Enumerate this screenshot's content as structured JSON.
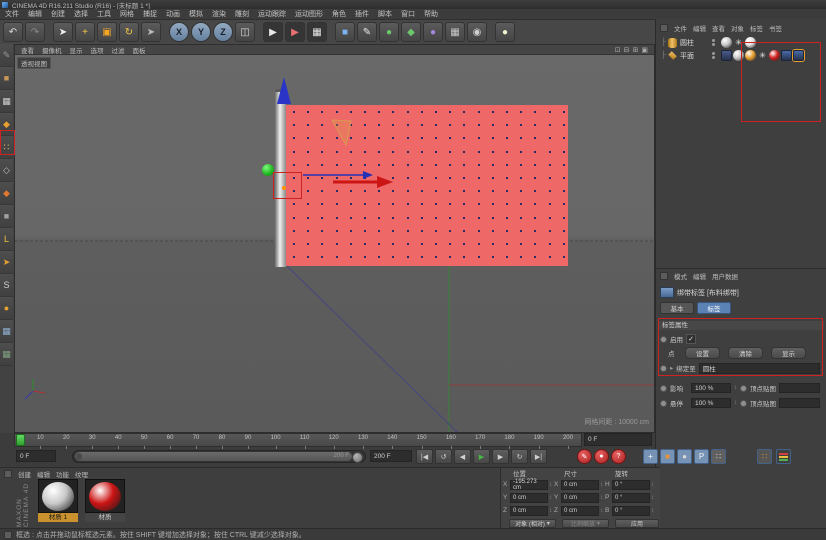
{
  "window": {
    "title": "CINEMA 4D R16.211 Studio (R16) - [未标题 1 *]"
  },
  "menu_bar": {
    "items": [
      "文件",
      "编辑",
      "创建",
      "选择",
      "工具",
      "网格",
      "捕捉",
      "动画",
      "模拟",
      "渲染",
      "雕刻",
      "运动跟踪",
      "运动图形",
      "角色",
      "插件",
      "脚本",
      "窗口",
      "帮助"
    ]
  },
  "toolbar": {
    "items": [
      {
        "name": "undo-icon",
        "glyph": "↶",
        "color": "#d8d8d8"
      },
      {
        "name": "redo-icon",
        "glyph": "↷",
        "color": "#8a8a8a"
      },
      {
        "sep": true
      },
      {
        "name": "live-selection-icon",
        "glyph": "➤",
        "color": "#f0f0f0"
      },
      {
        "name": "move-tool-icon",
        "glyph": "+",
        "color": "#f5c542"
      },
      {
        "name": "scale-tool-icon",
        "glyph": "▣",
        "color": "#f5a623"
      },
      {
        "name": "rotate-tool-icon",
        "glyph": "↻",
        "color": "#f5c542"
      },
      {
        "name": "last-tool-icon",
        "glyph": "➤",
        "color": "#bdbdbd"
      },
      {
        "sep": true
      },
      {
        "name": "lock-x-icon",
        "glyph": "X",
        "round": true
      },
      {
        "name": "lock-y-icon",
        "glyph": "Y",
        "round": true
      },
      {
        "name": "lock-z-icon",
        "glyph": "Z",
        "round": true
      },
      {
        "name": "coordinate-system-icon",
        "glyph": "◫",
        "color": "#d8d8d8"
      },
      {
        "sep": true
      },
      {
        "name": "render-view-icon",
        "glyph": "▶",
        "color": "#e8e8e8",
        "bg": "#353535"
      },
      {
        "name": "render-picture-viewer-icon",
        "glyph": "▶",
        "color": "#e87070",
        "bg": "#353535"
      },
      {
        "name": "render-settings-icon",
        "glyph": "▦",
        "color": "#e8e8e8",
        "bg": "#353535"
      },
      {
        "sep": true
      },
      {
        "name": "add-cube-icon",
        "glyph": "■",
        "color": "#7ab4f0"
      },
      {
        "name": "spline-pen-icon",
        "glyph": "✎",
        "color": "#e8e8e8"
      },
      {
        "name": "generators-icon",
        "glyph": "●",
        "color": "#6cc86c"
      },
      {
        "name": "deformers-icon",
        "glyph": "◆",
        "color": "#6cc86c"
      },
      {
        "name": "environment-icon",
        "glyph": "●",
        "color": "#a488e0"
      },
      {
        "name": "floor-icon",
        "glyph": "▦",
        "color": "#c8c8c8"
      },
      {
        "name": "camera-icon",
        "glyph": "◉",
        "color": "#d0d0d0"
      },
      {
        "sep": true
      },
      {
        "name": "light-icon",
        "glyph": "●",
        "color": "#f5f2d0"
      }
    ]
  },
  "left_toolbar": {
    "items": [
      {
        "name": "make-editable-icon",
        "glyph": "✎",
        "color": "#9a9a9a"
      },
      {
        "name": "model-mode-icon",
        "glyph": "■",
        "color": "#c89858"
      },
      {
        "name": "texture-mode-icon",
        "glyph": "▦",
        "color": "#d0d0d0"
      },
      {
        "name": "workplane-mode-icon",
        "glyph": "◆",
        "color": "#e8a030"
      },
      {
        "name": "points-mode-icon",
        "glyph": "∷",
        "color": "#e8c060"
      },
      {
        "name": "edges-mode-icon",
        "glyph": "◇",
        "color": "#c0c0c0"
      },
      {
        "name": "polygons-mode-icon",
        "glyph": "◆",
        "color": "#e07830"
      },
      {
        "name": "tweak-mode-icon",
        "glyph": "■",
        "color": "#a0a0a0"
      },
      {
        "name": "enable-axis-icon",
        "glyph": "L",
        "color": "#f0c040"
      },
      {
        "name": "viewport-solo-icon",
        "glyph": "➤",
        "color": "#e8a030"
      },
      {
        "name": "snap-icon",
        "glyph": "S",
        "color": "#d0d0d0"
      },
      {
        "name": "magnet-snap-icon",
        "glyph": "●",
        "color": "#e8a030"
      },
      {
        "name": "lock-workplane-icon",
        "glyph": "▦",
        "color": "#90b0d0"
      },
      {
        "name": "workplane-icon",
        "glyph": "▦",
        "color": "#80a080"
      }
    ]
  },
  "viewport": {
    "menu": [
      "查看",
      "摄像机",
      "显示",
      "选项",
      "过滤",
      "面板"
    ],
    "corner_icons": [
      {
        "name": "pane-toggle-icon-1",
        "glyph": "⊡"
      },
      {
        "name": "pane-toggle-icon-2",
        "glyph": "⊟"
      },
      {
        "name": "pane-toggle-icon-3",
        "glyph": "⊞"
      },
      {
        "name": "pane-maximize-icon",
        "glyph": "▣"
      }
    ],
    "view_label": "透视视图",
    "grid_label": "网格间距 : 10000 cm",
    "flag": {
      "rows": 12,
      "cols": 20
    }
  },
  "object_manager": {
    "menu": [
      "文件",
      "编辑",
      "查看",
      "对象",
      "标签",
      "书签"
    ],
    "objects": [
      {
        "name": "圆柱",
        "icon": "cylinder",
        "tags": [
          {
            "name": "phong-tag",
            "type": "ball",
            "color": "#c8c8c8"
          },
          {
            "name": "simulation-tag",
            "type": "glyph",
            "glyph": "✳",
            "color": "#e8e8e8"
          },
          {
            "name": "material-tag-silver",
            "type": "ball",
            "color": "#e0e0e0"
          }
        ]
      },
      {
        "name": "平面",
        "icon": "plane",
        "tags": [
          {
            "name": "cloth-tag",
            "type": "box",
            "color": "#4a5a8a"
          },
          {
            "name": "phong-tag",
            "type": "ball",
            "color": "#c8c8c8"
          },
          {
            "name": "display-tag",
            "type": "ball",
            "color": "#e8a030"
          },
          {
            "name": "simulation-tag",
            "type": "glyph",
            "glyph": "✳",
            "color": "#e8e8e8"
          },
          {
            "name": "material-tag-red",
            "type": "ball",
            "color": "#d02020"
          },
          {
            "name": "cloth-collider-tag",
            "type": "box",
            "color": "#4a6aa8"
          },
          {
            "name": "cloth-belt-tag",
            "type": "box",
            "color": "#4a6aa8",
            "selected": true
          }
        ]
      }
    ]
  },
  "attribute_manager": {
    "menu": [
      "模式",
      "编辑",
      "用户数据"
    ],
    "title": "绑带标签 [布料绑带]",
    "tabs": [
      "基本",
      "标签"
    ],
    "section": "标签属性",
    "enable_label": "启用",
    "points_label": "点",
    "point_buttons": [
      "设置",
      "清除",
      "显示"
    ],
    "belt_on_label": "绑定至",
    "belt_on_value": "圆柱",
    "rows": [
      {
        "label": "影响",
        "value": "100 %",
        "map_label": "顶点贴图"
      },
      {
        "label": "悬停",
        "value": "100 %",
        "map_label": "顶点贴图"
      }
    ]
  },
  "timeline": {
    "ticks": [
      "10",
      "20",
      "30",
      "40",
      "50",
      "60",
      "70",
      "80",
      "90",
      "100",
      "110",
      "120",
      "130",
      "140",
      "150",
      "160",
      "170",
      "180",
      "190",
      "200"
    ],
    "current_frame": "0 F",
    "range_start": "0 F",
    "range_end": "200 F",
    "slider_label": "200 F"
  },
  "transport": {
    "buttons": [
      {
        "name": "goto-start-button",
        "glyph": "|◀"
      },
      {
        "name": "previous-key-button",
        "glyph": "↺"
      },
      {
        "name": "previous-frame-button",
        "glyph": "◀"
      },
      {
        "name": "play-button",
        "glyph": "▶",
        "color": "#46b846"
      },
      {
        "name": "next-frame-button",
        "glyph": "▶"
      },
      {
        "name": "next-key-button",
        "glyph": "↻"
      },
      {
        "name": "goto-end-button",
        "glyph": "▶|"
      }
    ],
    "record_buttons": [
      {
        "name": "record-keyframe-button",
        "glyph": "✎"
      },
      {
        "name": "autokey-button",
        "glyph": "●"
      },
      {
        "name": "keyframe-selection-button",
        "glyph": "?"
      }
    ],
    "toggle_buttons": [
      {
        "name": "record-position-toggle",
        "glyph": "+",
        "color": "#ffffff",
        "bg": "#7693b5"
      },
      {
        "name": "record-scale-toggle",
        "glyph": "■",
        "color": "#e8933a",
        "bg": "#7693b5"
      },
      {
        "name": "record-rotation-toggle",
        "glyph": "●",
        "color": "#d8d8d8",
        "bg": "#7693b5"
      },
      {
        "name": "record-parameter-toggle",
        "glyph": "P",
        "color": "#f0f0f0",
        "bg": "#7693b5"
      },
      {
        "name": "record-pla-toggle",
        "glyph": "∷",
        "color": "#e8e8e8",
        "bg": "#606060"
      }
    ],
    "extra_icons": [
      {
        "name": "dots-grid-icon",
        "glyph": "∷",
        "color": "#e8a030",
        "bg": "#555555"
      },
      {
        "name": "stacked-bars-icon",
        "type": "bars"
      }
    ]
  },
  "materials": {
    "menu": [
      "创建",
      "编辑",
      "功能",
      "纹理"
    ],
    "brand": "MAXON CINEMA 4D",
    "items": [
      {
        "name": "材质 1",
        "color": "#c8c8c8",
        "selected": true
      },
      {
        "name": "材质",
        "color": "#cc1414",
        "selected": false
      }
    ]
  },
  "coordinates": {
    "headers": [
      "位置",
      "尺寸",
      "旋转"
    ],
    "rows": [
      {
        "pos_label": "X",
        "pos": "-195.273 cm",
        "size_label": "X",
        "size": "0 cm",
        "rot_label": "H",
        "rot": "0 °"
      },
      {
        "pos_label": "Y",
        "pos": "0 cm",
        "size_label": "Y",
        "size": "0 cm",
        "rot_label": "P",
        "rot": "0 °"
      },
      {
        "pos_label": "Z",
        "pos": "0 cm",
        "size_label": "Z",
        "size": "0 cm",
        "rot_label": "B",
        "rot": "0 °"
      }
    ],
    "mode_dropdown": "对象 (相对)",
    "size_dropdown": "比例缩放",
    "apply_button": "应用"
  },
  "status_bar": {
    "text": "框选 : 点击并拖动鼠标框选元素。按住 SHIFT 键增加选择对象；按住 CTRL 键减少选择对象。"
  },
  "colors": {
    "flag": "#ef6868",
    "annotation": "#cc2222",
    "selection_blue": "#5b82b5",
    "material_label_selected": "#c9922e",
    "play_green": "#46b846",
    "axis_x": "#b03030",
    "axis_y": "#2e8b2e",
    "axis_z": "#3a3ab0"
  }
}
